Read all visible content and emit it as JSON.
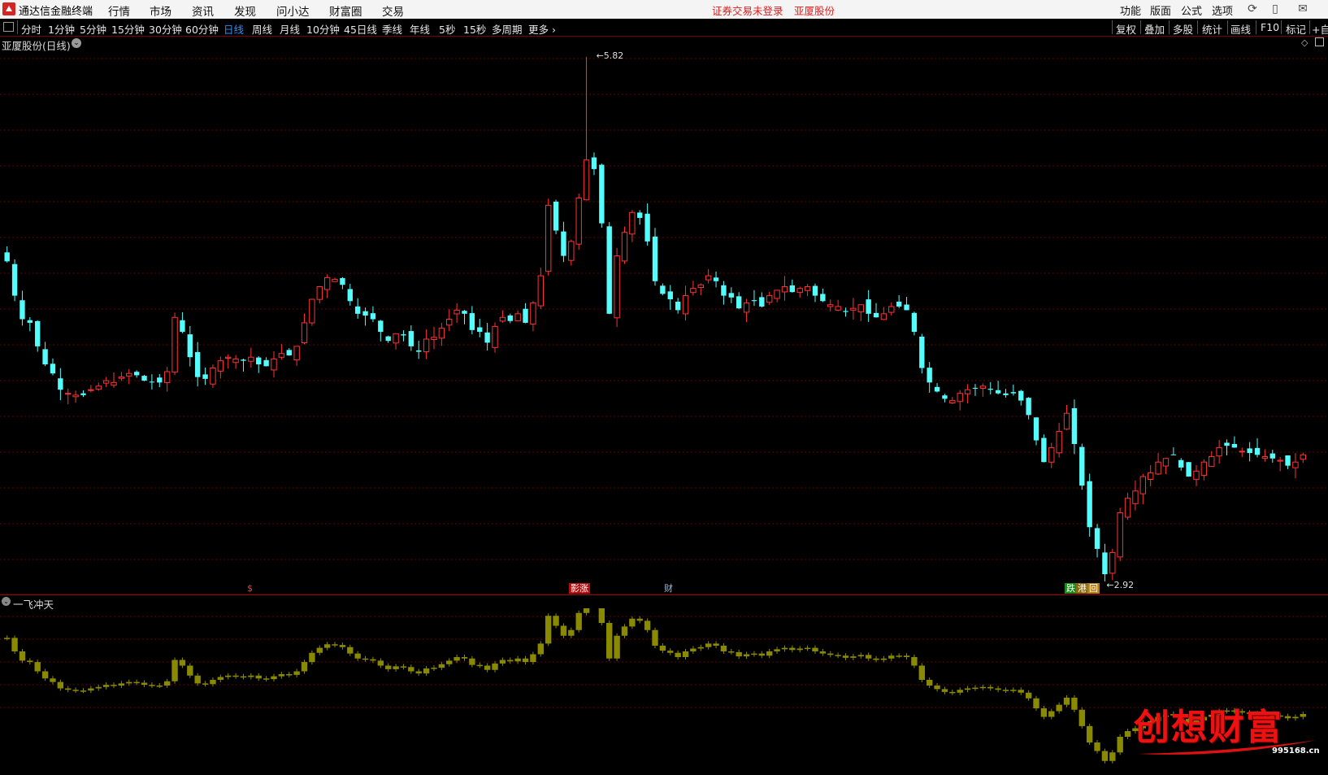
{
  "titlebar": {
    "app_title": "通达信金融终端",
    "menu": [
      "行情",
      "市场",
      "资讯",
      "发现",
      "问小达",
      "财富圈",
      "交易"
    ],
    "notice": "证券交易未登录",
    "stock_name": "亚厦股份",
    "right_menu": [
      "功能",
      "版面",
      "公式",
      "选项"
    ],
    "icons": [
      "refresh-icon",
      "phone-icon",
      "mail-icon"
    ]
  },
  "periodbar": {
    "items": [
      "分时",
      "1分钟",
      "5分钟",
      "15分钟",
      "30分钟",
      "60分钟",
      "日线",
      "周线",
      "月线",
      "10分钟",
      "45日线",
      "季线",
      "年线",
      "5秒",
      "15秒",
      "多周期",
      "更多"
    ],
    "active": "日线",
    "more_arrow": "›",
    "right_items": [
      "复权",
      "叠加",
      "多股",
      "统计",
      "画线",
      "F10",
      "标记",
      "+自"
    ]
  },
  "chart": {
    "title": "亚厦股份(日线)",
    "high_label": "5.82",
    "low_label": "2.92",
    "events": [
      {
        "text": "$",
        "color": "#ff3b3b",
        "bg": "#000"
      },
      {
        "text": "影涨",
        "color": "#fff",
        "bg": "#b01010"
      },
      {
        "text": "财",
        "color": "#9bd",
        "bg": "#000"
      },
      {
        "text": "跌",
        "color": "#fff",
        "bg": "#1a8a1a"
      },
      {
        "text": "港",
        "color": "#fff",
        "bg": "#8a6a10"
      },
      {
        "text": "回",
        "color": "#fff",
        "bg": "#b08020"
      }
    ],
    "colors": {
      "up": "#ff3232",
      "down": "#54fcfc",
      "grid": "#6a0000",
      "indicator": "#8a8a00"
    }
  },
  "indicator": {
    "title": "一飞冲天"
  },
  "watermark": {
    "text": "创想财富",
    "url": "995168.cn"
  },
  "chart_data": {
    "type": "candlestick",
    "title": "亚厦股份(日线)",
    "price_max": 5.82,
    "price_min": 2.92,
    "note": "daily candles; values estimated from visible chart",
    "close": [
      4.69,
      4.5,
      4.37,
      4.35,
      4.22,
      4.12,
      4.07,
      3.98,
      3.96,
      3.95,
      3.95,
      3.98,
      4.0,
      4.03,
      4.02,
      4.05,
      4.07,
      4.06,
      4.03,
      4.02,
      4.02,
      4.08,
      4.38,
      4.3,
      4.16,
      4.05,
      4.04,
      4.1,
      4.14,
      4.16,
      4.15,
      4.14,
      4.16,
      4.12,
      4.11,
      4.15,
      4.18,
      4.17,
      4.22,
      4.35,
      4.48,
      4.55,
      4.6,
      4.59,
      4.56,
      4.47,
      4.4,
      4.39,
      4.37,
      4.3,
      4.25,
      4.29,
      4.28,
      4.22,
      4.19,
      4.26,
      4.27,
      4.32,
      4.37,
      4.42,
      4.4,
      4.31,
      4.3,
      4.24,
      4.33,
      4.38,
      4.36,
      4.4,
      4.35,
      4.46,
      4.61,
      5.0,
      4.86,
      4.72,
      4.8,
      5.04,
      5.25,
      5.2,
      4.9,
      4.4,
      4.72,
      4.85,
      4.96,
      4.93,
      4.8,
      4.58,
      4.51,
      4.48,
      4.42,
      4.5,
      4.54,
      4.56,
      4.61,
      4.58,
      4.5,
      4.49,
      4.43,
      4.46,
      4.47,
      4.44,
      4.5,
      4.53,
      4.55,
      4.52,
      4.54,
      4.55,
      4.5,
      4.47,
      4.45,
      4.44,
      4.41,
      4.43,
      4.45,
      4.4,
      4.38,
      4.4,
      4.44,
      4.44,
      4.42,
      4.3,
      4.1,
      4.02,
      3.97,
      3.93,
      3.92,
      3.96,
      3.98,
      3.99,
      4.0,
      3.98,
      3.96,
      3.95,
      3.96,
      3.92,
      3.84,
      3.7,
      3.58,
      3.66,
      3.75,
      3.85,
      3.68,
      3.45,
      3.22,
      3.1,
      2.96,
      3.08,
      3.3,
      3.38,
      3.42,
      3.5,
      3.52,
      3.58,
      3.6,
      3.62,
      3.55,
      3.5,
      3.53,
      3.58,
      3.61,
      3.66,
      3.67,
      3.66,
      3.64,
      3.63,
      3.62,
      3.61,
      3.6,
      3.59,
      3.56,
      3.58,
      3.62
    ]
  }
}
